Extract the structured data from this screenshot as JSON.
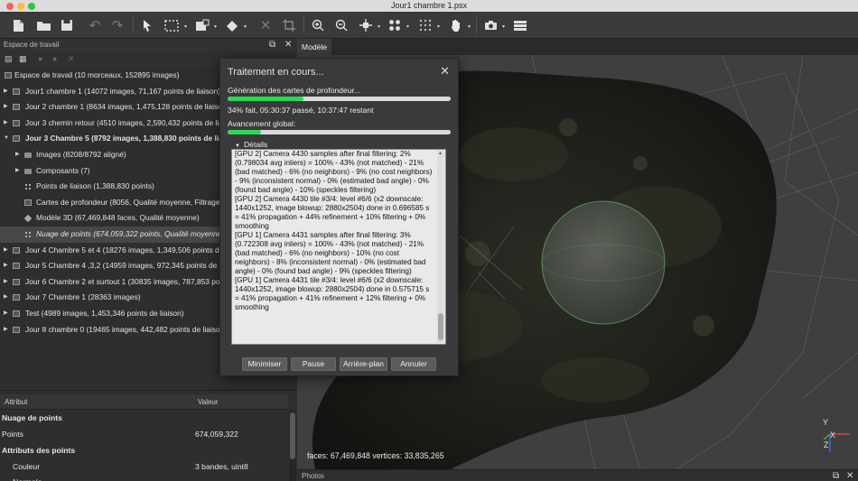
{
  "window": {
    "title": "Jour1 chambre 1.psx"
  },
  "colors": {
    "progress_fill": "#2bd957",
    "progress_track": "#d9d9d9",
    "traffic_close": "#fe5f57",
    "traffic_min": "#febc2e",
    "traffic_max": "#28c840"
  },
  "toolbar": {
    "icons": [
      "new-document-icon",
      "open-folder-icon",
      "save-icon",
      "undo-icon",
      "redo-icon",
      "navigation-arrow-icon",
      "rectangle-selection-icon",
      "resize-region-icon",
      "rotate-region-icon",
      "delete-icon",
      "crop-icon",
      "zoom-in-icon",
      "zoom-out-icon",
      "move-object-icon",
      "show-cameras-icon",
      "show-points-icon",
      "hand-tool-icon",
      "capture-view-icon",
      "layers-icon"
    ]
  },
  "workspace": {
    "panel_title": "Espace de travail",
    "root_label": "Espace de travail (10 morceaux, 152895 images)",
    "items": [
      {
        "label": "Jour1 chambre 1 (14072 images, 71,167 points de liaison)"
      },
      {
        "label": "Jour 2 chambre 1 (8634 images, 1,475,128 points de liaison)"
      },
      {
        "label": "Jour 3 chemin retour (4510 images, 2,590,432 points de liaison)"
      },
      {
        "label": "Jour 3 Chambre 5 (8792 images, 1,388,830 points de liaison)"
      },
      {
        "label": "Images (8208/8792 aligné)"
      },
      {
        "label": "Composants (7)"
      },
      {
        "label": "Points de liaison (1,388,830 points)"
      },
      {
        "label": "Cartes de profondeur (8056, Qualité moyenne, Filtrage modéré)"
      },
      {
        "label": "Modèle 3D (67,469,848 faces, Qualité moyenne)"
      },
      {
        "label": "Nuage de points (674,059,322 points, Qualité moyenne)"
      },
      {
        "label": "Jour 4 Chambre 5 et 4 (18276 images, 1,349,506 points de liaison)"
      },
      {
        "label": "Jour 5 Chambre 4 ,3,2 (14959 images, 972,345 points de liaison)"
      },
      {
        "label": "Jour 6 Chambre 2 et surtout 1 (30835 images, 787,853 points de liaison)"
      },
      {
        "label": "Jour 7 Chambre 1 (28363 images)"
      },
      {
        "label": "Test (4989 images, 1,453,346 points de liaison)"
      },
      {
        "label": "Jour 8 chambre 0 (19465 images, 442,482 points de liaison)"
      }
    ]
  },
  "attributes": {
    "col_attribute": "Attribut",
    "col_value": "Valeur",
    "rows": [
      {
        "key": "Nuage de points",
        "value": ""
      },
      {
        "key": "Points",
        "value": "674,059,322"
      },
      {
        "key": "Attributs des points",
        "value": ""
      },
      {
        "key": "Couleur",
        "value": "3 bandes, uint8"
      },
      {
        "key": "Normale",
        "value": ""
      }
    ]
  },
  "model_view": {
    "tab_label": "Modèle",
    "stats": "faces: 67,469,848 vertices: 33,835,265",
    "axes": {
      "x": "X",
      "y": "Y",
      "z": "Z"
    }
  },
  "photos_panel": {
    "title": "Photos"
  },
  "dialog": {
    "title": "Traitement en cours...",
    "task_label": "Génération des cartes de profondeur...",
    "task_progress": 0.34,
    "task_status": "34% fait, 05:30:37 passé, 10:37:47 restant",
    "overall_label": "Avancement global:",
    "overall_progress": 0.15,
    "details_label": "Détails",
    "log_lines": [
      "[GPU 2] Camera 4430 samples after final filtering: 2% (0.798034 avg inliers) = 100% - 43% (not matched) - 21% (bad matched) - 6% (no neighbors) - 9% (no cost neighbors) - 9% (inconsistent normal) - 0% (estimated bad angle) - 0% (found bad angle) - 10% (speckles filtering)",
      "[GPU 2] Camera 4430 tile #3/4: level #6/6 (x2 downscale: 1440x1252, image blowup: 2880x2504) done in 0.696585 s = 41% propagation + 44% refinement + 10% filtering + 0% smoothing",
      "[GPU 1] Camera 4431 samples after final filtering: 3% (0.722308 avg inliers) = 100% - 43% (not matched) - 21% (bad matched) - 6% (no neighbors) - 10% (no cost neighbors) - 8% (inconsistent normal) - 0% (estimated bad angle) - 0% (found bad angle) - 9% (speckles filtering)",
      "[GPU 1] Camera 4431 tile #3/4: level #6/6 (x2 downscale: 1440x1252, image blowup: 2880x2504) done in 0.575715 s = 41% propagation + 41% refinement + 12% filtering + 0% smoothing"
    ],
    "buttons": {
      "minimize": "Minimiser",
      "pause": "Pause",
      "background": "Arrière-plan",
      "cancel": "Annuler"
    }
  }
}
